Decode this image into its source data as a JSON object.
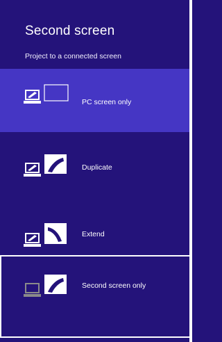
{
  "panel": {
    "title": "Second screen",
    "subtitle": "Project to a connected screen"
  },
  "options": [
    {
      "label": "PC screen only",
      "icon": "pc-screen-only-icon",
      "selected": true
    },
    {
      "label": "Duplicate",
      "icon": "duplicate-icon",
      "selected": false
    },
    {
      "label": "Extend",
      "icon": "extend-icon",
      "selected": false
    },
    {
      "label": "Second screen only",
      "icon": "second-screen-only-icon",
      "selected": false,
      "focused": true
    }
  ],
  "colors": {
    "background": "#24137a",
    "selected": "#4536c4",
    "foreground": "#ffffff",
    "dim_laptop": "#8a8a8a"
  }
}
